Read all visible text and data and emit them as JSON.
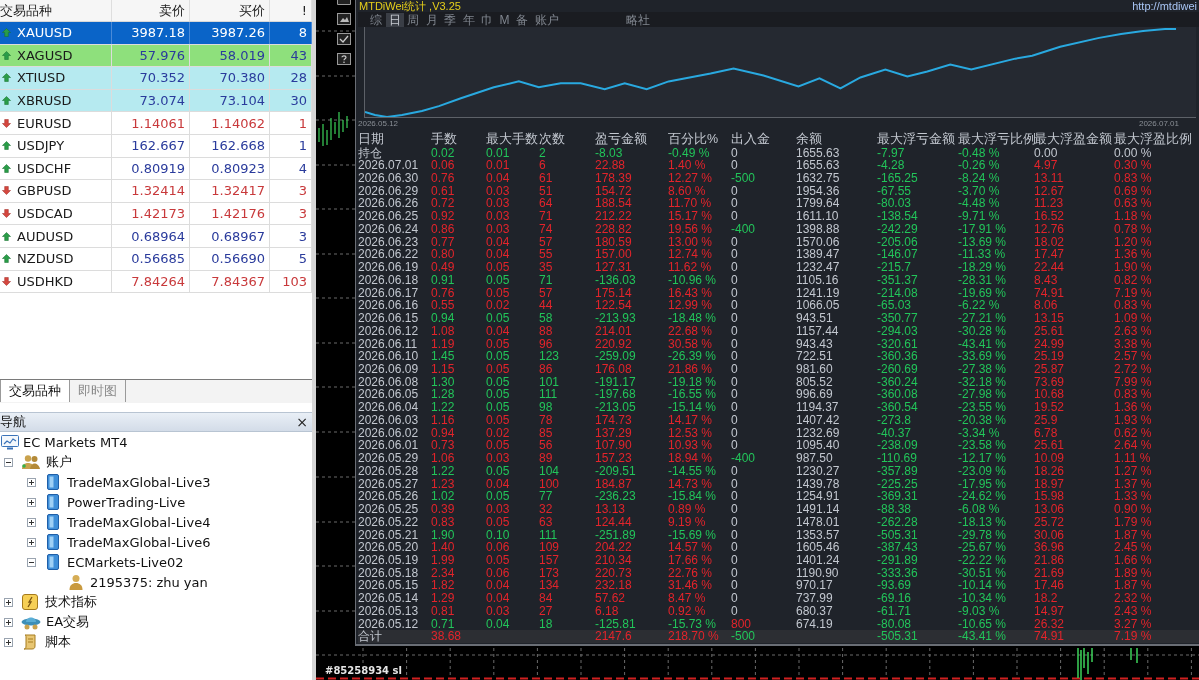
{
  "market_watch": {
    "columns": [
      "交易品种",
      "卖价",
      "买价",
      "!"
    ],
    "rows": [
      {
        "symbol": "XAUUSD",
        "bid": "3987.18",
        "ask": "3987.26",
        "spread": "8",
        "kind": "up",
        "selected": true
      },
      {
        "symbol": "XAGUSD",
        "bid": "57.976",
        "ask": "58.019",
        "spread": "43",
        "kind": "up",
        "selected": false,
        "color": "#8ee07c"
      },
      {
        "symbol": "XTIUSD",
        "bid": "70.352",
        "ask": "70.380",
        "spread": "28",
        "kind": "up",
        "selected": false,
        "color": "#b6eaf0"
      },
      {
        "symbol": "XBRUSD",
        "bid": "73.074",
        "ask": "73.104",
        "spread": "30",
        "kind": "up",
        "selected": false,
        "color": "#b6eaf0"
      },
      {
        "symbol": "EURUSD",
        "bid": "1.14061",
        "ask": "1.14062",
        "spread": "1",
        "kind": "down",
        "selected": false
      },
      {
        "symbol": "USDJPY",
        "bid": "162.667",
        "ask": "162.668",
        "spread": "1",
        "kind": "up",
        "selected": false
      },
      {
        "symbol": "USDCHF",
        "bid": "0.80919",
        "ask": "0.80923",
        "spread": "4",
        "kind": "up",
        "selected": false
      },
      {
        "symbol": "GBPUSD",
        "bid": "1.32414",
        "ask": "1.32417",
        "spread": "3",
        "kind": "down",
        "selected": false
      },
      {
        "symbol": "USDCAD",
        "bid": "1.42173",
        "ask": "1.42176",
        "spread": "3",
        "kind": "down",
        "selected": false
      },
      {
        "symbol": "AUDUSD",
        "bid": "0.68964",
        "ask": "0.68967",
        "spread": "3",
        "kind": "up",
        "selected": false
      },
      {
        "symbol": "NZDUSD",
        "bid": "0.56685",
        "ask": "0.56690",
        "spread": "5",
        "kind": "up",
        "selected": false
      },
      {
        "symbol": "USDHKD",
        "bid": "7.84264",
        "ask": "7.84367",
        "spread": "103",
        "kind": "down",
        "selected": false
      }
    ]
  },
  "left_tabs": [
    {
      "label": "交易品种",
      "selected": true
    },
    {
      "label": "即时图",
      "selected": false
    }
  ],
  "navigator": {
    "title": "导航",
    "close": "×",
    "tree": [
      {
        "label": "EC Markets MT4",
        "kind": "terminal",
        "children": [
          {
            "label": "账户",
            "kind": "accounts",
            "expanded": true,
            "children": [
              {
                "label": "TradeMaxGlobal-Live3",
                "kind": "server",
                "expanded": false
              },
              {
                "label": "PowerTrading-Live",
                "kind": "server",
                "expanded": false
              },
              {
                "label": "TradeMaxGlobal-Live4",
                "kind": "server",
                "expanded": false
              },
              {
                "label": "TradeMaxGlobal-Live6",
                "kind": "server",
                "expanded": false
              },
              {
                "label": "ECMarkets-Live02",
                "kind": "server",
                "expanded": true,
                "children": [
                  {
                    "label": "2195375: zhu yan",
                    "kind": "account"
                  }
                ]
              }
            ]
          },
          {
            "label": "技术指标",
            "kind": "indicators",
            "expanded": false
          },
          {
            "label": "EA交易",
            "kind": "experts",
            "expanded": false
          },
          {
            "label": "脚本",
            "kind": "scripts",
            "expanded": false
          }
        ]
      }
    ]
  },
  "stats_panel": {
    "title": "MTDiWei统计 ,V3.25",
    "url": "http://mtdiwei",
    "tabs": [
      {
        "label": "综",
        "selected": false
      },
      {
        "label": "日",
        "selected": true
      },
      {
        "label": "周",
        "selected": false
      },
      {
        "label": "月",
        "selected": false
      },
      {
        "label": "季",
        "selected": false
      },
      {
        "label": "年",
        "selected": false
      },
      {
        "label": "巾",
        "selected": false
      },
      {
        "label": "M",
        "selected": false
      },
      {
        "label": "备",
        "selected": false
      },
      {
        "label": "账户",
        "selected": false
      }
    ],
    "mode_label": "略社",
    "chart": {
      "start_date": "2026.05.12",
      "end_date": "2026.07.01"
    },
    "table": {
      "columns": [
        "日期",
        "手数",
        "最大手数",
        "次数",
        "盈亏金额",
        "百分比%",
        "出入金",
        "余额",
        "最大浮亏金额",
        "最大浮亏比例",
        "最大浮盈金额",
        "最大浮盈比例"
      ],
      "rows": [
        {
          "date": "持仓",
          "color": "#22c55a",
          "values": [
            "0.02",
            "0.01",
            "2",
            "-8.03",
            "-0.49 %"
          ],
          "flow": {
            "text": "0",
            "color": "#c3c8d0"
          },
          "balance": "1655.63",
          "float_loss": [
            "-7.97",
            "-0.48 %"
          ],
          "float_profit": {
            "values": [
              "0.00",
              "0.00 %"
            ],
            "color": "#c3c8d0"
          }
        },
        {
          "date": "2026.07.01",
          "color": "#e3242b",
          "values": [
            "0.06",
            "0.01",
            "6",
            "22.88",
            "1.40 %"
          ],
          "flow": {
            "text": "0",
            "color": "#c3c8d0"
          },
          "balance": "1655.63",
          "float_loss": [
            "-4.28",
            "-0.26 %"
          ],
          "float_profit": {
            "values": [
              "4.97",
              "0.30 %"
            ],
            "color": "#e3242b"
          }
        },
        {
          "date": "2026.06.30",
          "color": "#e3242b",
          "values": [
            "0.76",
            "0.04",
            "61",
            "178.39",
            "12.27 %"
          ],
          "flow": {
            "text": "-500",
            "color": "#22c55a"
          },
          "balance": "1632.75",
          "float_loss": [
            "-165.25",
            "-8.24 %"
          ],
          "float_profit": {
            "values": [
              "13.11",
              "0.83 %"
            ],
            "color": "#e3242b"
          }
        },
        {
          "date": "2026.06.29",
          "color": "#e3242b",
          "values": [
            "0.61",
            "0.03",
            "51",
            "154.72",
            "8.60 %"
          ],
          "flow": {
            "text": "0",
            "color": "#c3c8d0"
          },
          "balance": "1954.36",
          "float_loss": [
            "-67.55",
            "-3.70 %"
          ],
          "float_profit": {
            "values": [
              "12.67",
              "0.69 %"
            ],
            "color": "#e3242b"
          }
        },
        {
          "date": "2026.06.26",
          "color": "#e3242b",
          "values": [
            "0.72",
            "0.03",
            "64",
            "188.54",
            "11.70 %"
          ],
          "flow": {
            "text": "0",
            "color": "#c3c8d0"
          },
          "balance": "1799.64",
          "float_loss": [
            "-80.03",
            "-4.48 %"
          ],
          "float_profit": {
            "values": [
              "11.23",
              "0.63 %"
            ],
            "color": "#e3242b"
          }
        },
        {
          "date": "2026.06.25",
          "color": "#e3242b",
          "values": [
            "0.92",
            "0.03",
            "71",
            "212.22",
            "15.17 %"
          ],
          "flow": {
            "text": "0",
            "color": "#c3c8d0"
          },
          "balance": "1611.10",
          "float_loss": [
            "-138.54",
            "-9.71 %"
          ],
          "float_profit": {
            "values": [
              "16.52",
              "1.18 %"
            ],
            "color": "#e3242b"
          }
        },
        {
          "date": "2026.06.24",
          "color": "#e3242b",
          "values": [
            "0.86",
            "0.03",
            "74",
            "228.82",
            "19.56 %"
          ],
          "flow": {
            "text": "-400",
            "color": "#22c55a"
          },
          "balance": "1398.88",
          "float_loss": [
            "-242.29",
            "-17.91 %"
          ],
          "float_profit": {
            "values": [
              "12.76",
              "0.78 %"
            ],
            "color": "#e3242b"
          }
        },
        {
          "date": "2026.06.23",
          "color": "#e3242b",
          "values": [
            "0.77",
            "0.04",
            "57",
            "180.59",
            "13.00 %"
          ],
          "flow": {
            "text": "0",
            "color": "#c3c8d0"
          },
          "balance": "1570.06",
          "float_loss": [
            "-205.06",
            "-13.69 %"
          ],
          "float_profit": {
            "values": [
              "18.02",
              "1.20 %"
            ],
            "color": "#e3242b"
          }
        },
        {
          "date": "2026.06.22",
          "color": "#e3242b",
          "values": [
            "0.80",
            "0.04",
            "55",
            "157.00",
            "12.74 %"
          ],
          "flow": {
            "text": "0",
            "color": "#c3c8d0"
          },
          "balance": "1389.47",
          "float_loss": [
            "-146.07",
            "-11.33 %"
          ],
          "float_profit": {
            "values": [
              "17.47",
              "1.36 %"
            ],
            "color": "#e3242b"
          }
        },
        {
          "date": "2026.06.19",
          "color": "#e3242b",
          "values": [
            "0.49",
            "0.05",
            "35",
            "127.31",
            "11.62 %"
          ],
          "flow": {
            "text": "0",
            "color": "#c3c8d0"
          },
          "balance": "1232.47",
          "float_loss": [
            "-215.7",
            "-18.29 %"
          ],
          "float_profit": {
            "values": [
              "22.44",
              "1.90 %"
            ],
            "color": "#e3242b"
          }
        },
        {
          "date": "2026.06.18",
          "color": "#22c55a",
          "values": [
            "0.91",
            "0.05",
            "71",
            "-136.03",
            "-10.96 %"
          ],
          "flow": {
            "text": "0",
            "color": "#c3c8d0"
          },
          "balance": "1105.16",
          "float_loss": [
            "-351.37",
            "-28.31 %"
          ],
          "float_profit": {
            "values": [
              "8.43",
              "0.82 %"
            ],
            "color": "#e3242b"
          }
        },
        {
          "date": "2026.06.17",
          "color": "#e3242b",
          "values": [
            "0.76",
            "0.05",
            "57",
            "175.14",
            "16.43 %"
          ],
          "flow": {
            "text": "0",
            "color": "#c3c8d0"
          },
          "balance": "1241.19",
          "float_loss": [
            "-214.08",
            "-19.69 %"
          ],
          "float_profit": {
            "values": [
              "74.91",
              "7.19 %"
            ],
            "color": "#e3242b"
          }
        },
        {
          "date": "2026.06.16",
          "color": "#e3242b",
          "values": [
            "0.55",
            "0.02",
            "44",
            "122.54",
            "12.99 %"
          ],
          "flow": {
            "text": "0",
            "color": "#c3c8d0"
          },
          "balance": "1066.05",
          "float_loss": [
            "-65.03",
            "-6.22 %"
          ],
          "float_profit": {
            "values": [
              "8.06",
              "0.83 %"
            ],
            "color": "#e3242b"
          }
        },
        {
          "date": "2026.06.15",
          "color": "#22c55a",
          "values": [
            "0.94",
            "0.05",
            "58",
            "-213.93",
            "-18.48 %"
          ],
          "flow": {
            "text": "0",
            "color": "#c3c8d0"
          },
          "balance": "943.51",
          "float_loss": [
            "-350.77",
            "-27.21 %"
          ],
          "float_profit": {
            "values": [
              "13.15",
              "1.09 %"
            ],
            "color": "#e3242b"
          }
        },
        {
          "date": "2026.06.12",
          "color": "#e3242b",
          "values": [
            "1.08",
            "0.04",
            "88",
            "214.01",
            "22.68 %"
          ],
          "flow": {
            "text": "0",
            "color": "#c3c8d0"
          },
          "balance": "1157.44",
          "float_loss": [
            "-294.03",
            "-30.28 %"
          ],
          "float_profit": {
            "values": [
              "25.61",
              "2.63 %"
            ],
            "color": "#e3242b"
          }
        },
        {
          "date": "2026.06.11",
          "color": "#e3242b",
          "values": [
            "1.19",
            "0.05",
            "96",
            "220.92",
            "30.58 %"
          ],
          "flow": {
            "text": "0",
            "color": "#c3c8d0"
          },
          "balance": "943.43",
          "float_loss": [
            "-320.61",
            "-43.41 %"
          ],
          "float_profit": {
            "values": [
              "24.99",
              "3.38 %"
            ],
            "color": "#e3242b"
          }
        },
        {
          "date": "2026.06.10",
          "color": "#22c55a",
          "values": [
            "1.45",
            "0.05",
            "123",
            "-259.09",
            "-26.39 %"
          ],
          "flow": {
            "text": "0",
            "color": "#c3c8d0"
          },
          "balance": "722.51",
          "float_loss": [
            "-360.36",
            "-33.69 %"
          ],
          "float_profit": {
            "values": [
              "25.19",
              "2.57 %"
            ],
            "color": "#e3242b"
          }
        },
        {
          "date": "2026.06.09",
          "color": "#e3242b",
          "values": [
            "1.15",
            "0.05",
            "86",
            "176.08",
            "21.86 %"
          ],
          "flow": {
            "text": "0",
            "color": "#c3c8d0"
          },
          "balance": "981.60",
          "float_loss": [
            "-260.69",
            "-27.38 %"
          ],
          "float_profit": {
            "values": [
              "25.87",
              "2.72 %"
            ],
            "color": "#e3242b"
          }
        },
        {
          "date": "2026.06.08",
          "color": "#22c55a",
          "values": [
            "1.30",
            "0.05",
            "101",
            "-191.17",
            "-19.18 %"
          ],
          "flow": {
            "text": "0",
            "color": "#c3c8d0"
          },
          "balance": "805.52",
          "float_loss": [
            "-360.24",
            "-32.18 %"
          ],
          "float_profit": {
            "values": [
              "73.69",
              "7.99 %"
            ],
            "color": "#e3242b"
          }
        },
        {
          "date": "2026.06.05",
          "color": "#22c55a",
          "values": [
            "1.28",
            "0.05",
            "111",
            "-197.68",
            "-16.55 %"
          ],
          "flow": {
            "text": "0",
            "color": "#c3c8d0"
          },
          "balance": "996.69",
          "float_loss": [
            "-360.08",
            "-27.98 %"
          ],
          "float_profit": {
            "values": [
              "10.68",
              "0.83 %"
            ],
            "color": "#e3242b"
          }
        },
        {
          "date": "2026.06.04",
          "color": "#22c55a",
          "values": [
            "1.22",
            "0.05",
            "98",
            "-213.05",
            "-15.14 %"
          ],
          "flow": {
            "text": "0",
            "color": "#c3c8d0"
          },
          "balance": "1194.37",
          "float_loss": [
            "-360.54",
            "-23.55 %"
          ],
          "float_profit": {
            "values": [
              "19.52",
              "1.36 %"
            ],
            "color": "#e3242b"
          }
        },
        {
          "date": "2026.06.03",
          "color": "#e3242b",
          "values": [
            "1.16",
            "0.05",
            "78",
            "174.73",
            "14.17 %"
          ],
          "flow": {
            "text": "0",
            "color": "#c3c8d0"
          },
          "balance": "1407.42",
          "float_loss": [
            "-273.8",
            "-20.38 %"
          ],
          "float_profit": {
            "values": [
              "25.9",
              "1.93 %"
            ],
            "color": "#e3242b"
          }
        },
        {
          "date": "2026.06.02",
          "color": "#e3242b",
          "values": [
            "0.94",
            "0.02",
            "85",
            "137.29",
            "12.53 %"
          ],
          "flow": {
            "text": "0",
            "color": "#c3c8d0"
          },
          "balance": "1232.69",
          "float_loss": [
            "-40.37",
            "-3.34 %"
          ],
          "float_profit": {
            "values": [
              "6.78",
              "0.62 %"
            ],
            "color": "#e3242b"
          }
        },
        {
          "date": "2026.06.01",
          "color": "#e3242b",
          "values": [
            "0.73",
            "0.05",
            "56",
            "107.90",
            "10.93 %"
          ],
          "flow": {
            "text": "0",
            "color": "#c3c8d0"
          },
          "balance": "1095.40",
          "float_loss": [
            "-238.09",
            "-23.58 %"
          ],
          "float_profit": {
            "values": [
              "25.61",
              "2.64 %"
            ],
            "color": "#e3242b"
          }
        },
        {
          "date": "2026.05.29",
          "color": "#e3242b",
          "values": [
            "1.06",
            "0.03",
            "89",
            "157.23",
            "18.94 %"
          ],
          "flow": {
            "text": "-400",
            "color": "#22c55a"
          },
          "balance": "987.50",
          "float_loss": [
            "-110.69",
            "-12.17 %"
          ],
          "float_profit": {
            "values": [
              "10.09",
              "1.11 %"
            ],
            "color": "#e3242b"
          }
        },
        {
          "date": "2026.05.28",
          "color": "#22c55a",
          "values": [
            "1.22",
            "0.05",
            "104",
            "-209.51",
            "-14.55 %"
          ],
          "flow": {
            "text": "0",
            "color": "#c3c8d0"
          },
          "balance": "1230.27",
          "float_loss": [
            "-357.89",
            "-23.09 %"
          ],
          "float_profit": {
            "values": [
              "18.26",
              "1.27 %"
            ],
            "color": "#e3242b"
          }
        },
        {
          "date": "2026.05.27",
          "color": "#e3242b",
          "values": [
            "1.23",
            "0.04",
            "100",
            "184.87",
            "14.73 %"
          ],
          "flow": {
            "text": "0",
            "color": "#c3c8d0"
          },
          "balance": "1439.78",
          "float_loss": [
            "-225.25",
            "-17.95 %"
          ],
          "float_profit": {
            "values": [
              "18.97",
              "1.37 %"
            ],
            "color": "#e3242b"
          }
        },
        {
          "date": "2026.05.26",
          "color": "#22c55a",
          "values": [
            "1.02",
            "0.05",
            "77",
            "-236.23",
            "-15.84 %"
          ],
          "flow": {
            "text": "0",
            "color": "#c3c8d0"
          },
          "balance": "1254.91",
          "float_loss": [
            "-369.31",
            "-24.62 %"
          ],
          "float_profit": {
            "values": [
              "15.98",
              "1.33 %"
            ],
            "color": "#e3242b"
          }
        },
        {
          "date": "2026.05.25",
          "color": "#e3242b",
          "values": [
            "0.39",
            "0.03",
            "32",
            "13.13",
            "0.89 %"
          ],
          "flow": {
            "text": "0",
            "color": "#c3c8d0"
          },
          "balance": "1491.14",
          "float_loss": [
            "-88.38",
            "-6.08 %"
          ],
          "float_profit": {
            "values": [
              "13.06",
              "0.90 %"
            ],
            "color": "#e3242b"
          }
        },
        {
          "date": "2026.05.22",
          "color": "#e3242b",
          "values": [
            "0.83",
            "0.05",
            "63",
            "124.44",
            "9.19 %"
          ],
          "flow": {
            "text": "0",
            "color": "#c3c8d0"
          },
          "balance": "1478.01",
          "float_loss": [
            "-262.28",
            "-18.13 %"
          ],
          "float_profit": {
            "values": [
              "25.72",
              "1.79 %"
            ],
            "color": "#e3242b"
          }
        },
        {
          "date": "2026.05.21",
          "color": "#22c55a",
          "values": [
            "1.90",
            "0.10",
            "111",
            "-251.89",
            "-15.69 %"
          ],
          "flow": {
            "text": "0",
            "color": "#c3c8d0"
          },
          "balance": "1353.57",
          "float_loss": [
            "-505.31",
            "-29.78 %"
          ],
          "float_profit": {
            "values": [
              "30.06",
              "1.87 %"
            ],
            "color": "#e3242b"
          }
        },
        {
          "date": "2026.05.20",
          "color": "#e3242b",
          "values": [
            "1.40",
            "0.06",
            "109",
            "204.22",
            "14.57 %"
          ],
          "flow": {
            "text": "0",
            "color": "#c3c8d0"
          },
          "balance": "1605.46",
          "float_loss": [
            "-387.43",
            "-25.67 %"
          ],
          "float_profit": {
            "values": [
              "36.96",
              "2.45 %"
            ],
            "color": "#e3242b"
          }
        },
        {
          "date": "2026.05.19",
          "color": "#e3242b",
          "values": [
            "1.99",
            "0.05",
            "157",
            "210.34",
            "17.66 %"
          ],
          "flow": {
            "text": "0",
            "color": "#c3c8d0"
          },
          "balance": "1401.24",
          "float_loss": [
            "-291.89",
            "-22.22 %"
          ],
          "float_profit": {
            "values": [
              "21.86",
              "1.66 %"
            ],
            "color": "#e3242b"
          }
        },
        {
          "date": "2026.05.18",
          "color": "#e3242b",
          "values": [
            "2.34",
            "0.06",
            "173",
            "220.73",
            "22.76 %"
          ],
          "flow": {
            "text": "0",
            "color": "#c3c8d0"
          },
          "balance": "1190.90",
          "float_loss": [
            "-333.36",
            "-30.51 %"
          ],
          "float_profit": {
            "values": [
              "21.69",
              "1.89 %"
            ],
            "color": "#e3242b"
          }
        },
        {
          "date": "2026.05.15",
          "color": "#e3242b",
          "values": [
            "1.82",
            "0.04",
            "134",
            "232.18",
            "31.46 %"
          ],
          "flow": {
            "text": "0",
            "color": "#c3c8d0"
          },
          "balance": "970.17",
          "float_loss": [
            "-93.69",
            "-10.14 %"
          ],
          "float_profit": {
            "values": [
              "17.46",
              "1.87 %"
            ],
            "color": "#e3242b"
          }
        },
        {
          "date": "2026.05.14",
          "color": "#e3242b",
          "values": [
            "1.29",
            "0.04",
            "84",
            "57.62",
            "8.47 %"
          ],
          "flow": {
            "text": "0",
            "color": "#c3c8d0"
          },
          "balance": "737.99",
          "float_loss": [
            "-69.16",
            "-10.34 %"
          ],
          "float_profit": {
            "values": [
              "18.2",
              "2.32 %"
            ],
            "color": "#e3242b"
          }
        },
        {
          "date": "2026.05.13",
          "color": "#e3242b",
          "values": [
            "0.81",
            "0.03",
            "27",
            "6.18",
            "0.92 %"
          ],
          "flow": {
            "text": "0",
            "color": "#c3c8d0"
          },
          "balance": "680.37",
          "float_loss": [
            "-61.71",
            "-9.03 %"
          ],
          "float_profit": {
            "values": [
              "14.97",
              "2.43 %"
            ],
            "color": "#e3242b"
          }
        },
        {
          "date": "2026.05.12",
          "color": "#22c55a",
          "values": [
            "0.71",
            "0.04",
            "18",
            "-125.81",
            "-15.73 %"
          ],
          "flow": {
            "text": "800",
            "color": "#e3242b"
          },
          "balance": "674.19",
          "float_loss": [
            "-80.08",
            "-10.65 %"
          ],
          "float_profit": {
            "values": [
              "26.32",
              "3.27 %"
            ],
            "color": "#e3242b"
          }
        }
      ],
      "total": {
        "label": "合计",
        "color": "#e3242b",
        "lots": "38.68",
        "pnl": "2147.6",
        "pct": "218.70 %",
        "flow": {
          "text": "-500",
          "color": "#22c55a"
        },
        "float_loss": [
          "-505.31",
          "-43.41 %"
        ],
        "float_profit": {
          "values": [
            "74.91",
            "7.19 %"
          ],
          "color": "#e3242b"
        }
      }
    }
  },
  "price_chart": {
    "order_label": "#85258934 sl"
  }
}
